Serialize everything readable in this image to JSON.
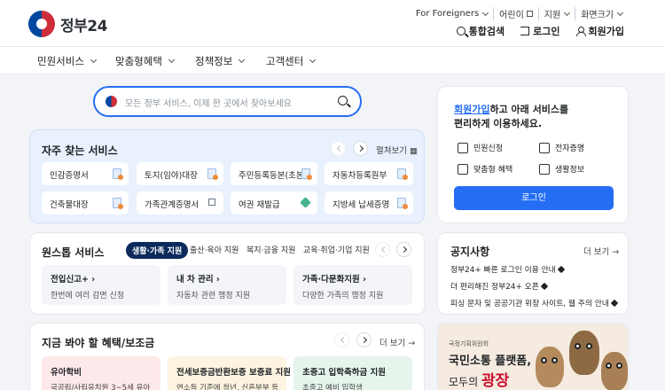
{
  "header": {
    "logo_text": "정부24",
    "util": [
      "For Foreigners",
      "어린이",
      "지원",
      "화면크기"
    ],
    "actions": [
      "통합검색",
      "로그인",
      "회원가입"
    ]
  },
  "nav": [
    "민원서비스",
    "맞춤형혜택",
    "정책정보",
    "고객센터"
  ],
  "search": {
    "placeholder": "모든 정부 서비스, 이제 한 곳에서 찾아보세요"
  },
  "frequent": {
    "title": "자주 찾는 서비스",
    "more": "펼쳐보기",
    "items": [
      "인감증명서",
      "토지(임야)대장",
      "주민등록등본(초본)",
      "자동차등록원부",
      "건축물대장",
      "가족관계증명서",
      "여권 재발급",
      "지방세 납세증명"
    ]
  },
  "onestop": {
    "title": "원스톱 서비스",
    "tabs": [
      "생활·가족 지원",
      "출산·육아 지원",
      "복지·금융 지원",
      "교육·취업·기업 지원"
    ],
    "boxes": [
      {
        "title": "전입신고+",
        "desc": "한번에 여러 감면 신청"
      },
      {
        "title": "내 차 관리",
        "desc": "자동차 관련 행정 지원"
      },
      {
        "title": "가족·다문화지원",
        "desc": "다양한 가족의 행정 지원"
      }
    ]
  },
  "benefit": {
    "title": "지금 봐야 할 혜택/보조금",
    "more": "더 보기",
    "cards": [
      {
        "title": "유아학비",
        "desc": "국공립/사립유치원 3~5세 유아"
      },
      {
        "title": "전세보증금반환보증 보증료 지원",
        "desc": "연소득 기준에 청년, 신혼부부 등"
      },
      {
        "title": "초중고 입학축하금 지원",
        "desc": "초중고 예비 입학생"
      }
    ]
  },
  "member": {
    "link": "회원가입",
    "msg1": "하고 아래 서비스를",
    "msg2": "편리하게 이용하세요.",
    "services": [
      "민원신청",
      "전자증명",
      "맞춤형 혜택",
      "생활정보"
    ],
    "login": "로그인"
  },
  "notice": {
    "title": "공지사항",
    "more": "더 보기",
    "items": [
      "정부24+ 빠른 로그인 이용 안내",
      "더 편리해진 정부24+ 오픈",
      "피싱 문자 및 공공기관 위장 사이트, 웹 주의 안내"
    ]
  },
  "banner": {
    "org": "국정기획위원회",
    "line1": "국민소통 플랫폼,",
    "line2a": "모두의",
    "line2b": "광장"
  }
}
